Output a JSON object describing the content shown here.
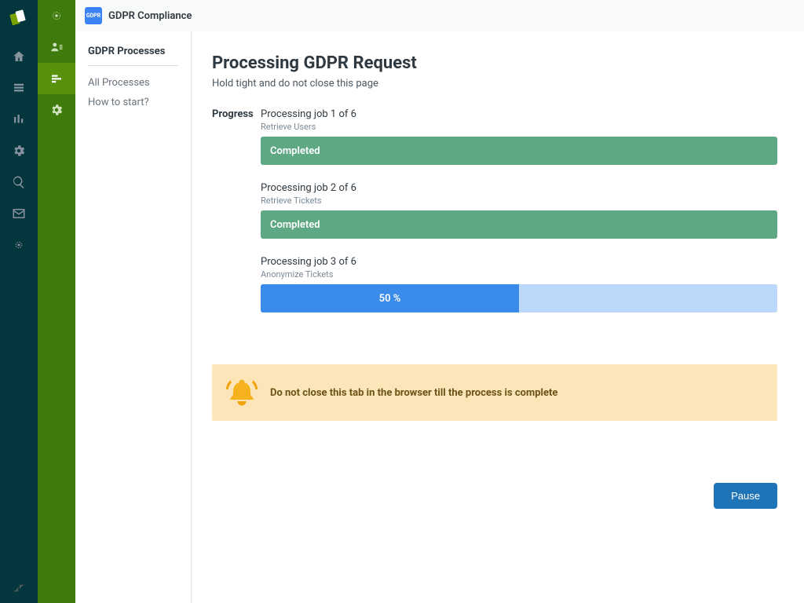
{
  "header": {
    "badge": "GDPR",
    "title": "GDPR Compliance"
  },
  "sidebar": {
    "heading": "GDPR Processes",
    "links": {
      "all": "All Processes",
      "how": "How to start?"
    }
  },
  "page": {
    "title": "Processing GDPR Request",
    "subtitle": "Hold tight and do not close this page",
    "progress_label": "Progress"
  },
  "jobs": {
    "j1": {
      "title": "Processing job 1 of 6",
      "sub": "Retrieve Users",
      "status": "Completed"
    },
    "j2": {
      "title": "Processing job 2 of 6",
      "sub": "Retrieve Tickets",
      "status": "Completed"
    },
    "j3": {
      "title": "Processing job 3 of 6",
      "sub": "Anonymize Tickets",
      "percent_label": "50 %",
      "percent": 50
    }
  },
  "notice": {
    "text": "Do not close this tab in the browser till the process is complete"
  },
  "actions": {
    "pause": "Pause"
  }
}
